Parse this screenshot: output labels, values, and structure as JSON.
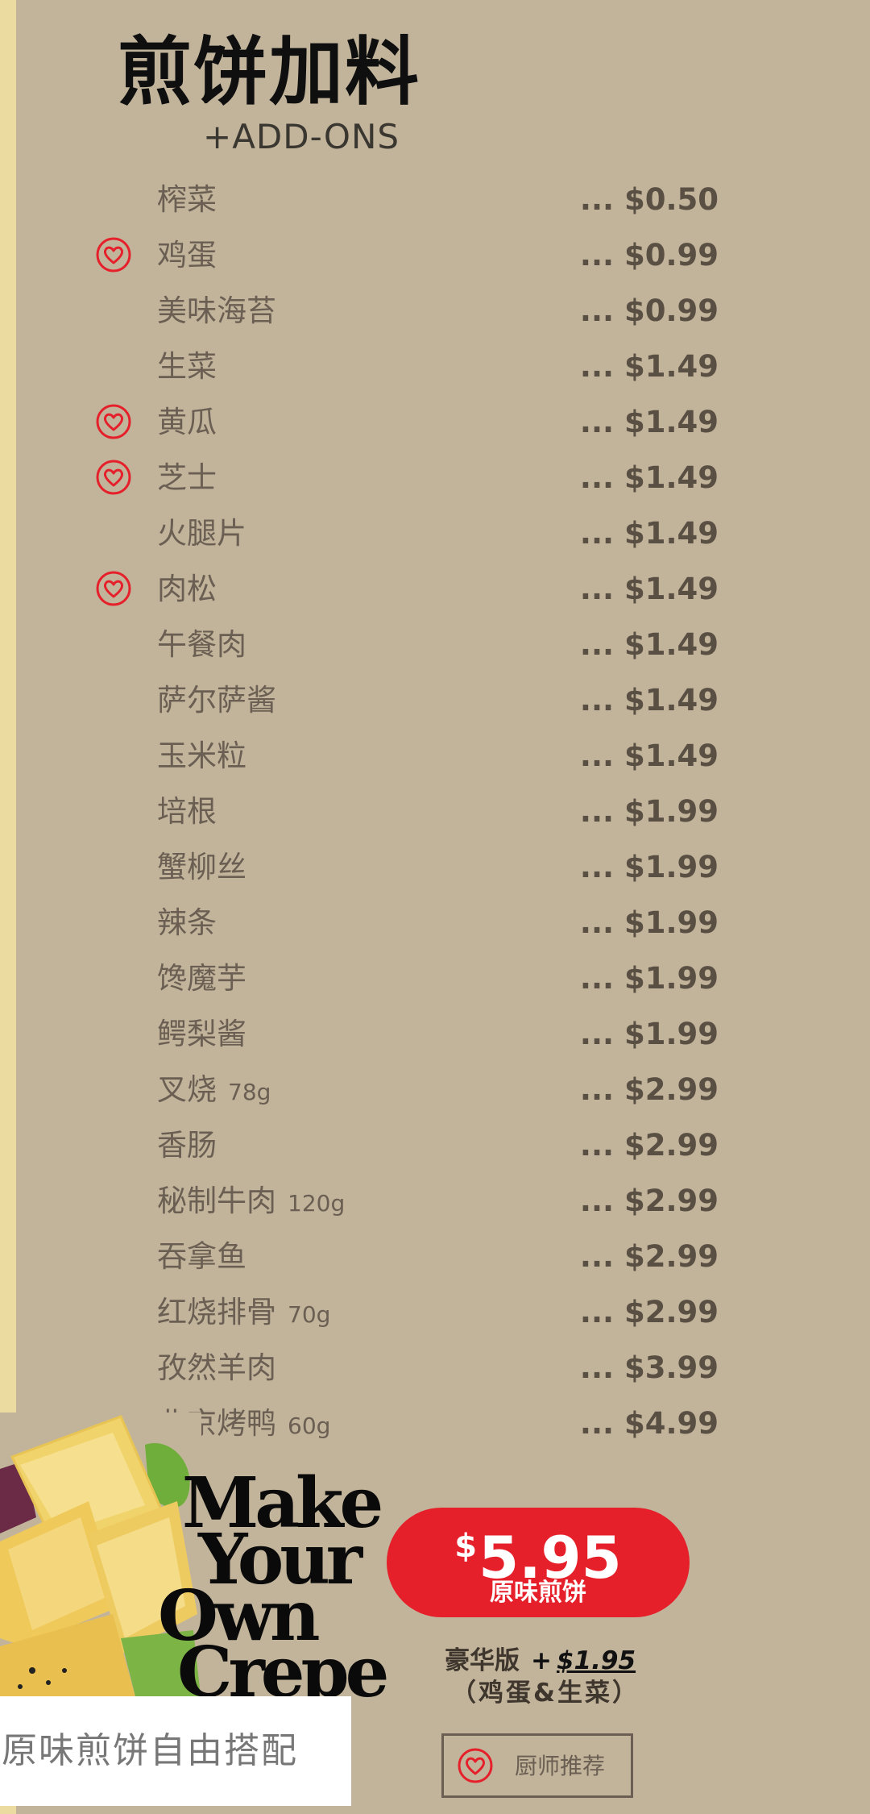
{
  "header": {
    "title": "煎饼加料",
    "subtitle": "+ADD-ONS"
  },
  "colors": {
    "background": "#c2b49b",
    "accent_red": "#e5202a",
    "left_strip": "#ecdba1"
  },
  "menu": {
    "items": [
      {
        "name": "榨菜",
        "weight": "",
        "price": "... $0.50",
        "recommended": false
      },
      {
        "name": "鸡蛋",
        "weight": "",
        "price": "... $0.99",
        "recommended": true
      },
      {
        "name": "美味海苔",
        "weight": "",
        "price": "... $0.99",
        "recommended": false
      },
      {
        "name": "生菜",
        "weight": "",
        "price": "... $1.49",
        "recommended": false
      },
      {
        "name": "黄瓜",
        "weight": "",
        "price": "... $1.49",
        "recommended": true
      },
      {
        "name": "芝士",
        "weight": "",
        "price": "... $1.49",
        "recommended": true
      },
      {
        "name": "火腿片",
        "weight": "",
        "price": "... $1.49",
        "recommended": false
      },
      {
        "name": "肉松",
        "weight": "",
        "price": "... $1.49",
        "recommended": true
      },
      {
        "name": "午餐肉",
        "weight": "",
        "price": "... $1.49",
        "recommended": false
      },
      {
        "name": "萨尔萨酱",
        "weight": "",
        "price": "... $1.49",
        "recommended": false
      },
      {
        "name": "玉米粒",
        "weight": "",
        "price": "... $1.49",
        "recommended": false
      },
      {
        "name": "培根",
        "weight": "",
        "price": "... $1.99",
        "recommended": false
      },
      {
        "name": "蟹柳丝",
        "weight": "",
        "price": "... $1.99",
        "recommended": false
      },
      {
        "name": "辣条",
        "weight": "",
        "price": "... $1.99",
        "recommended": false
      },
      {
        "name": "馋魔芋",
        "weight": "",
        "price": "... $1.99",
        "recommended": false
      },
      {
        "name": "鳄梨酱",
        "weight": "",
        "price": "... $1.99",
        "recommended": false
      },
      {
        "name": "叉烧",
        "weight": "78g",
        "price": "... $2.99",
        "recommended": false
      },
      {
        "name": "香肠",
        "weight": "",
        "price": "... $2.99",
        "recommended": false
      },
      {
        "name": "秘制牛肉",
        "weight": "120g",
        "price": "... $2.99",
        "recommended": false
      },
      {
        "name": "吞拿鱼",
        "weight": "",
        "price": "... $2.99",
        "recommended": false
      },
      {
        "name": "红烧排骨",
        "weight": "70g",
        "price": "... $2.99",
        "recommended": false
      },
      {
        "name": "孜然羊肉",
        "weight": "",
        "price": "... $3.99",
        "recommended": false
      },
      {
        "name": "北京烤鸭",
        "weight": "60g",
        "price": "... $4.99",
        "recommended": false
      }
    ]
  },
  "promo": {
    "slogan": [
      "Make",
      "Your",
      "Own",
      "Crepe"
    ],
    "price_symbol": "$",
    "price": "5.95",
    "price_label": "原味煎饼",
    "deluxe_label": "豪华版",
    "deluxe_plus": "+",
    "deluxe_extra": "$1.95",
    "deluxe_note": "（鸡蛋&生菜）",
    "free_combo": "原味煎饼自由搭配",
    "chef_label": "厨师推荐"
  },
  "icons": {
    "heart": "heart-in-circle-icon",
    "food": "crepe-food-photo"
  }
}
